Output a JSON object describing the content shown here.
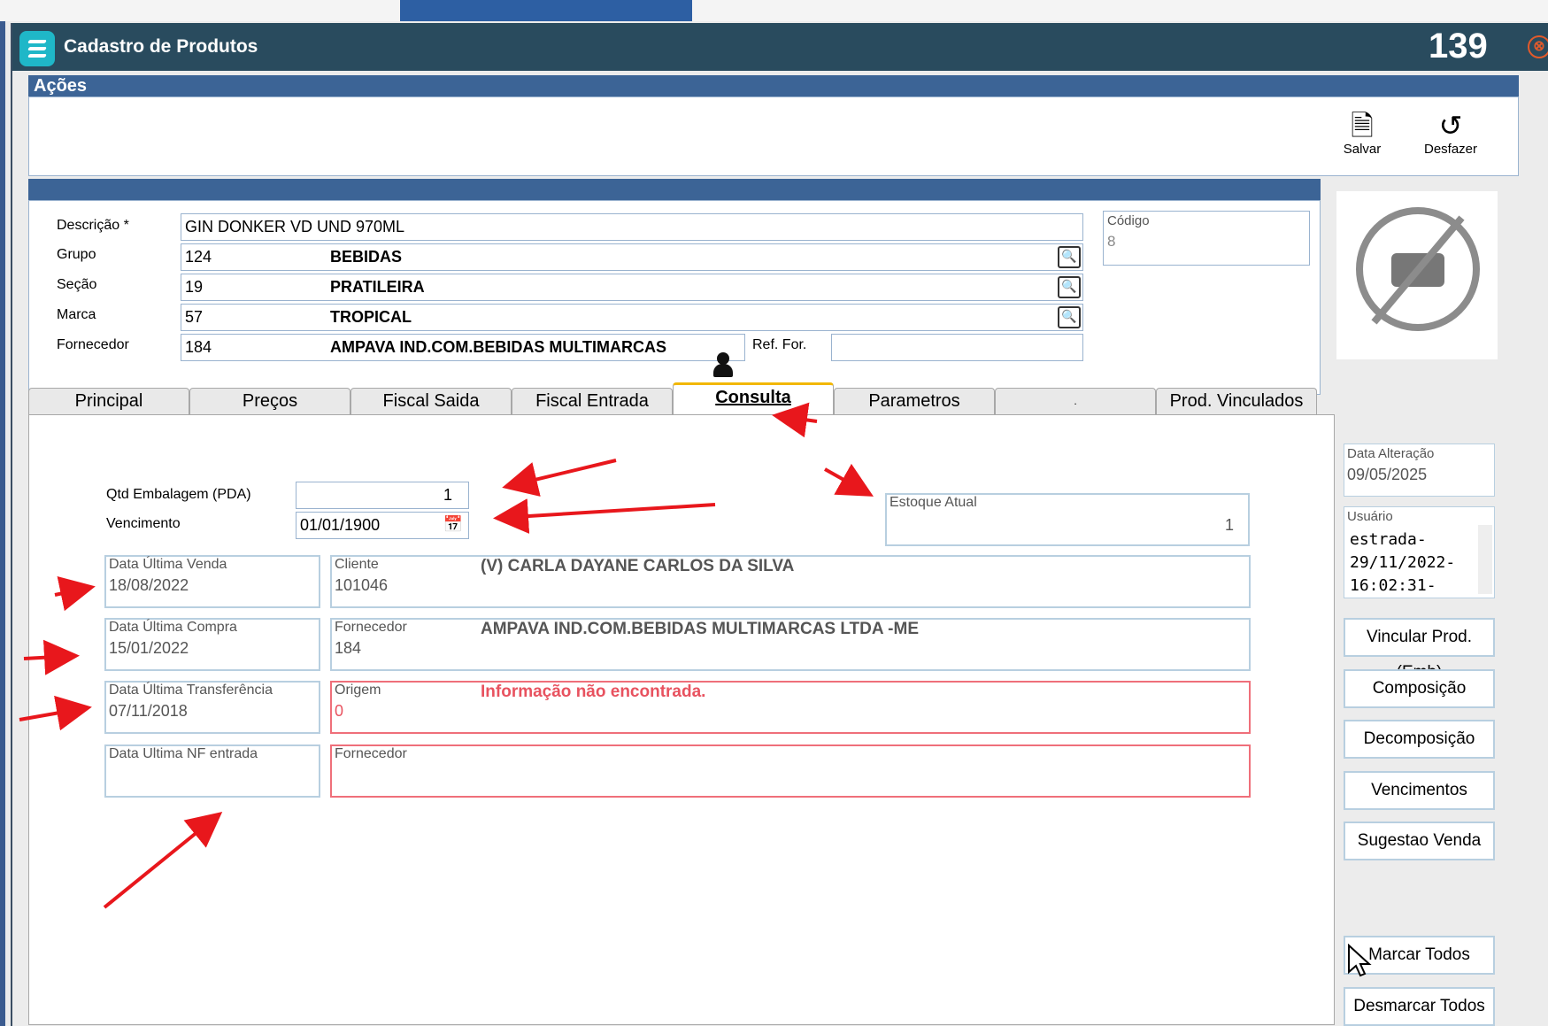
{
  "window": {
    "title": "Cadastro de Produtos",
    "counter": "139",
    "close_glyph": "⊗"
  },
  "acoes": {
    "header": "Ações",
    "save_label": "Salvar",
    "undo_label": "Desfazer",
    "save_icon": "save-icon",
    "undo_icon": "undo-icon"
  },
  "form": {
    "descricao_label": "Descrição *",
    "descricao_value": "GIN DONKER VD UND 970ML",
    "grupo_label": "Grupo",
    "grupo_code": "124",
    "grupo_desc": "BEBIDAS",
    "secao_label": "Seção",
    "secao_code": "19",
    "secao_desc": "PRATILEIRA",
    "marca_label": "Marca",
    "marca_code": "57",
    "marca_desc": "TROPICAL",
    "fornecedor_label": "Fornecedor",
    "fornecedor_code": "184",
    "fornecedor_desc": "AMPAVA IND.COM.BEBIDAS MULTIMARCAS",
    "ref_for_label": "Ref. For.",
    "ref_for_value": "",
    "codigo_label": "Código",
    "codigo_value": "8"
  },
  "tabs": [
    {
      "label": "Principal"
    },
    {
      "label": "Preços"
    },
    {
      "label": "Fiscal Saida"
    },
    {
      "label": "Fiscal Entrada"
    },
    {
      "label": "Consulta",
      "active": true
    },
    {
      "label": "Parametros"
    },
    {
      "label": "."
    },
    {
      "label": "Prod. Vinculados"
    }
  ],
  "consulta": {
    "qtd_label": "Qtd Embalagem (PDA)",
    "qtd_value": "1",
    "vencimento_label": "Vencimento",
    "vencimento_value": "01/01/1900",
    "estoque_label": "Estoque Atual",
    "estoque_value": "1",
    "ultima_venda_label": "Data Última Venda",
    "ultima_venda_value": "18/08/2022",
    "cliente_label": "Cliente",
    "cliente_code": "101046",
    "cliente_name": "(V) CARLA DAYANE CARLOS DA SILVA",
    "ultima_compra_label": "Data Última Compra",
    "ultima_compra_value": "15/01/2022",
    "fornecedor_label": "Fornecedor",
    "fornecedor_code": "184",
    "fornecedor_name": "AMPAVA IND.COM.BEBIDAS MULTIMARCAS LTDA -ME",
    "ultima_transf_label": "Data Última Transferência",
    "ultima_transf_value": "07/11/2018",
    "origem_label": "Origem",
    "origem_value": "0",
    "origem_msg": "Informação não encontrada.",
    "ultima_nf_label": "Data Ultima NF entrada",
    "ultima_nf_value": "",
    "nf_fornecedor_label": "Fornecedor",
    "nf_fornecedor_value": ""
  },
  "side": {
    "data_alteracao_label": "Data Alteração",
    "data_alteracao_value": "09/05/2025",
    "usuario_label": "Usuário",
    "usuario_lines": [
      "estrada-",
      "29/11/2022-",
      "16:02:31-"
    ],
    "buttons": [
      "Vincular Prod. (Emb)",
      "Composição",
      "Decomposição",
      "Vencimentos",
      "Sugestao Venda"
    ],
    "marcar_todos": "Marcar Todos",
    "desmarcar_todos": "Desmarcar Todos"
  },
  "colors": {
    "titlebar": "#294b5e",
    "section_header": "#3c6496",
    "accent_tab": "#f2b700",
    "alert_red": "#e8525f",
    "annotation_arrow": "#e8171c"
  }
}
